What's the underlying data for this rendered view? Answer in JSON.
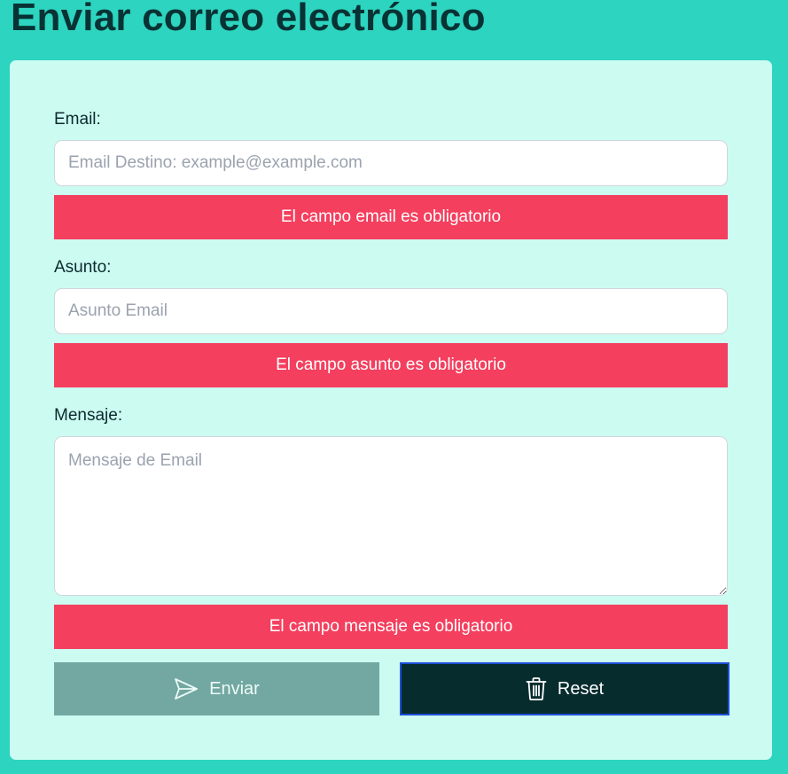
{
  "page": {
    "title": "Enviar correo electrónico"
  },
  "form": {
    "email": {
      "label": "Email:",
      "placeholder": "Email Destino: example@example.com",
      "value": "",
      "error": "El campo email es obligatorio"
    },
    "subject": {
      "label": "Asunto:",
      "placeholder": "Asunto Email",
      "value": "",
      "error": "El campo asunto es obligatorio"
    },
    "message": {
      "label": "Mensaje:",
      "placeholder": "Mensaje de Email",
      "value": "",
      "error": "El campo mensaje es obligatorio"
    }
  },
  "buttons": {
    "send": {
      "label": "Enviar",
      "icon": "paper-plane-icon",
      "disabled": true
    },
    "reset": {
      "label": "Reset",
      "icon": "trash-icon"
    }
  },
  "colors": {
    "background": "#2dd4bf",
    "card": "#ccfbf1",
    "error": "#f43f5e",
    "send_button": "#72a8a1",
    "reset_button": "#062c2e",
    "title": "#083234"
  }
}
